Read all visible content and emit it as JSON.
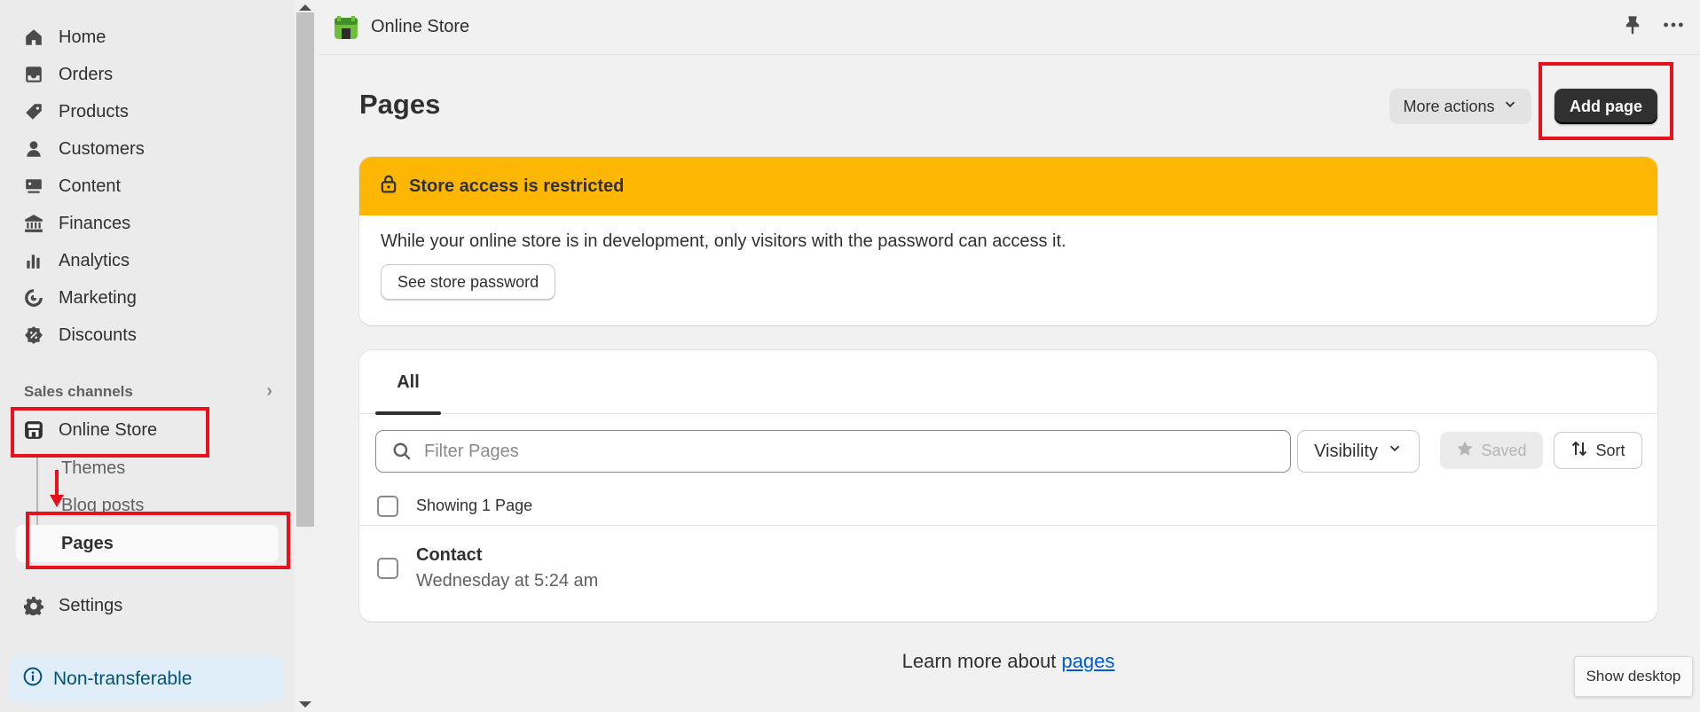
{
  "sidebar": {
    "items": [
      {
        "label": "Home",
        "icon": "home-icon"
      },
      {
        "label": "Orders",
        "icon": "inbox-icon"
      },
      {
        "label": "Products",
        "icon": "tag-icon"
      },
      {
        "label": "Customers",
        "icon": "person-icon"
      },
      {
        "label": "Content",
        "icon": "image-icon"
      },
      {
        "label": "Finances",
        "icon": "bank-icon"
      },
      {
        "label": "Analytics",
        "icon": "bar-chart-icon"
      },
      {
        "label": "Marketing",
        "icon": "target-icon"
      },
      {
        "label": "Discounts",
        "icon": "discount-icon"
      }
    ],
    "sales_channels_label": "Sales channels",
    "online_store_label": "Online Store",
    "sub_items": [
      "Themes",
      "Blog posts",
      "Pages"
    ],
    "settings_label": "Settings",
    "non_transferable_label": "Non-transferable"
  },
  "topbar": {
    "title": "Online Store"
  },
  "main": {
    "page_title": "Pages",
    "more_actions_label": "More actions",
    "add_page_label": "Add page",
    "banner": {
      "title": "Store access is restricted",
      "text": "While your online store is in development, only visitors with the password can access it.",
      "button_label": "See store password",
      "color": "#fdb702"
    },
    "tabs": [
      {
        "label": "All"
      }
    ],
    "search": {
      "placeholder": "Filter Pages"
    },
    "visibility_label": "Visibility",
    "saved_label": "Saved",
    "sort_label": "Sort",
    "showing_label": "Showing 1 Page",
    "rows": [
      {
        "name": "Contact",
        "date": "Wednesday at 5:24 am"
      }
    ],
    "learn_more_prefix": "Learn more about",
    "learn_more_link": "pages"
  },
  "show_desktop_label": "Show desktop",
  "colors": {
    "annotation_red": "#e8101a",
    "primary_button": "#303030",
    "link": "#005bd3"
  }
}
